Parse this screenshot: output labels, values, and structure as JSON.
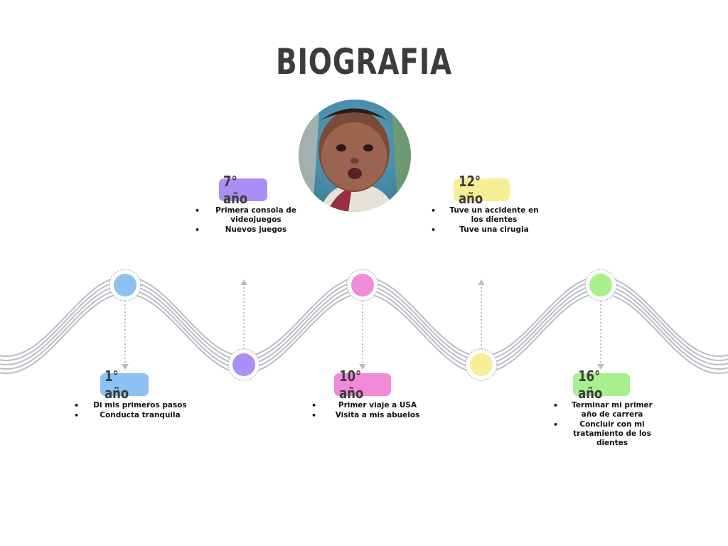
{
  "title": "BIOGRAFIA",
  "colors": {
    "wave": "#b9bdc4",
    "blue": "#8cc1f4",
    "purple": "#a98ef3",
    "pink": "#f18ad7",
    "yellow": "#f6ef95",
    "green": "#a8f08c",
    "text": "#3c3c3c"
  },
  "photo": {
    "icon": "baby-portrait"
  },
  "milestones": [
    {
      "label": "1° año",
      "color": "blue",
      "items": [
        "Di mis primeros pasos",
        "Conducta tranquila"
      ]
    },
    {
      "label": "7° año",
      "color": "purple",
      "items": [
        "Primera consola de videojuegos",
        "Nuevos juegos"
      ]
    },
    {
      "label": "10° año",
      "color": "pink",
      "items": [
        "Primer viaje a USA",
        "Visita a mis abuelos"
      ]
    },
    {
      "label": "12° año",
      "color": "yellow",
      "items": [
        "Tuve un accidente en los dientes",
        "Tuve una cirugia"
      ]
    },
    {
      "label": "16° año",
      "color": "green",
      "items": [
        "Terminar mi primer año de carrera",
        "Concluir con mi tratamiento de los dientes"
      ]
    }
  ]
}
